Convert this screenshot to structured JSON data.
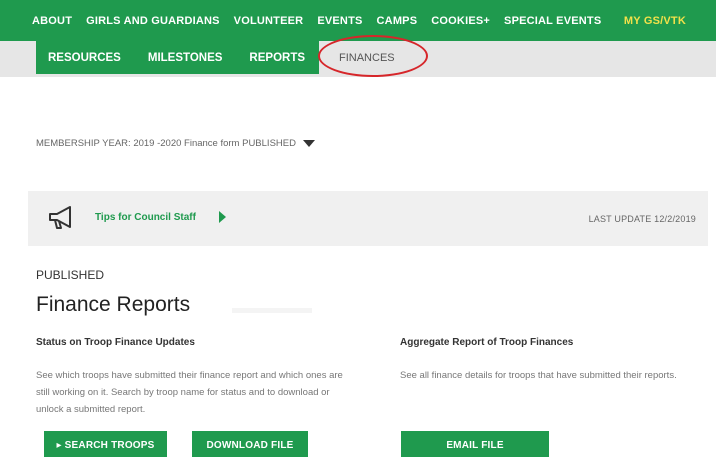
{
  "top_nav": {
    "items": [
      "ABOUT",
      "GIRLS AND GUARDIANS",
      "VOLUNTEER",
      "EVENTS",
      "CAMPS",
      "COOKIES+",
      "SPECIAL EVENTS"
    ],
    "my_account": "MY GS/VTK"
  },
  "sub_nav": {
    "tabs": [
      "RESOURCES",
      "MILESTONES",
      "REPORTS"
    ],
    "active_tab": "FINANCES",
    "highlight_color": "#d6262a"
  },
  "membership": {
    "label": "MEMBERSHIP YEAR:",
    "value": "2019 -2020 Finance form PUBLISHED"
  },
  "tips_bar": {
    "icon": "megaphone-icon",
    "link_text": "Tips for Council Staff",
    "last_update": "LAST UPDATE 12/2/2019"
  },
  "status_label": "PUBLISHED",
  "heading": "Finance Reports",
  "sections": [
    {
      "title": "Status on Troop Finance Updates",
      "description": "See which troops have submitted their finance report and which ones are still working on it. Search by troop name for status and to download or unlock a submitted report."
    },
    {
      "title": "Aggregate Report of Troop Finances",
      "description": "See all finance details for troops that have submitted their reports."
    }
  ],
  "buttons": {
    "search": "▸ SEARCH TROOPS",
    "download": "DOWNLOAD FILE",
    "email": "EMAIL FILE"
  },
  "colors": {
    "brand_green": "#1f9a4e",
    "account_yellow": "#f2e14a"
  }
}
